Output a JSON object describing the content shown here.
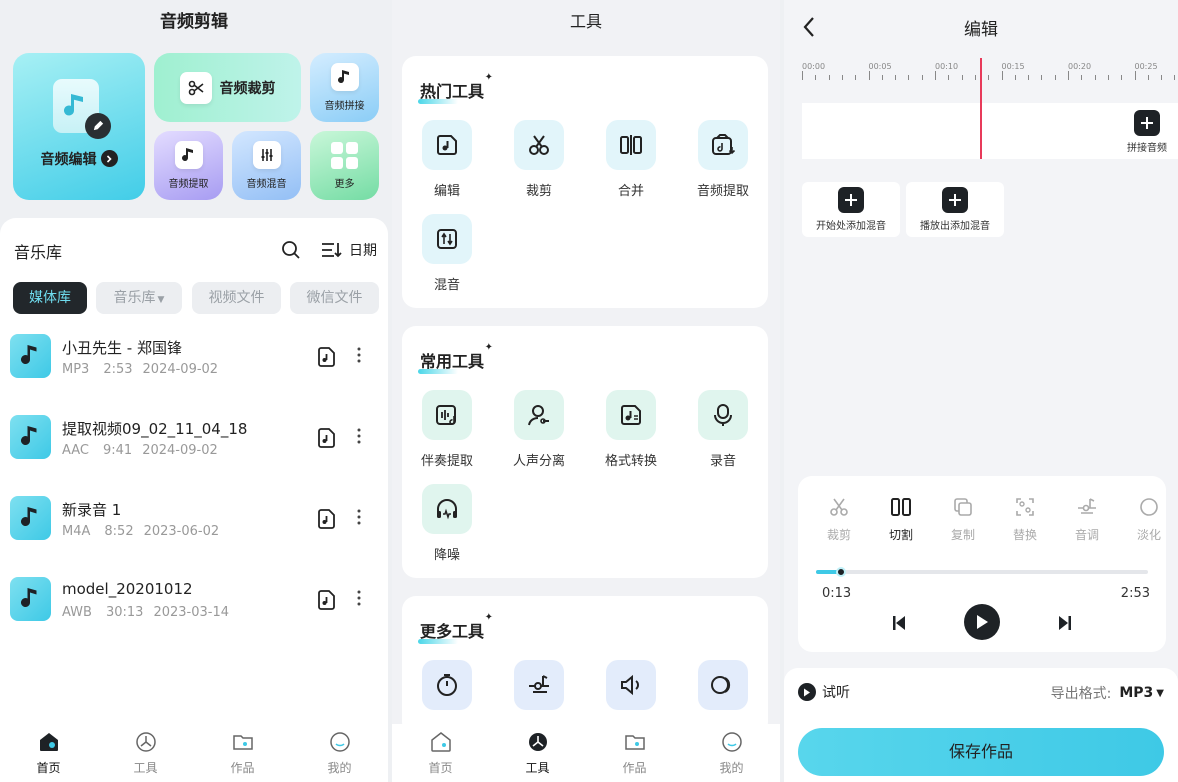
{
  "colors": {
    "accent": "#3ec9e6",
    "playhead": "#e83a5a",
    "dark": "#1e2226"
  },
  "home": {
    "title": "音频剪辑",
    "main_card": {
      "label": "音频编辑",
      "icon": "music-edit-icon"
    },
    "cards": [
      {
        "label": "音频裁剪",
        "icon": "scissors-icon"
      },
      {
        "label": "音频拼接",
        "icon": "splice-icon"
      },
      {
        "label": "音频提取",
        "icon": "extract-icon"
      },
      {
        "label": "音频混音",
        "icon": "mix-icon"
      },
      {
        "label": "更多",
        "icon": "grid-icon"
      }
    ],
    "library": {
      "title": "音乐库",
      "sort_label": "日期"
    },
    "filters": [
      "媒体库",
      "音乐库",
      "视频文件",
      "微信文件"
    ],
    "files": [
      {
        "name": "小丑先生 - 郑国锋",
        "format": "MP3",
        "duration": "2:53",
        "date": "2024-09-02"
      },
      {
        "name": "提取视频09_02_11_04_18",
        "format": "AAC",
        "duration": "9:41",
        "date": "2024-09-02"
      },
      {
        "name": "新录音 1",
        "format": "M4A",
        "duration": "8:52",
        "date": "2023-06-02"
      },
      {
        "name": "model_20201012",
        "format": "AWB",
        "duration": "30:13",
        "date": "2023-03-14"
      }
    ]
  },
  "tabbar": [
    "首页",
    "工具",
    "作品",
    "我的"
  ],
  "tools": {
    "title": "工具",
    "sections": [
      {
        "title": "热门工具",
        "items": [
          "编辑",
          "裁剪",
          "合并",
          "音频提取",
          "混音"
        ]
      },
      {
        "title": "常用工具",
        "items": [
          "伴奏提取",
          "人声分离",
          "格式转换",
          "录音",
          "降噪"
        ]
      },
      {
        "title": "更多工具",
        "items": [
          "",
          "",
          "",
          ""
        ]
      }
    ]
  },
  "editor": {
    "title": "编辑",
    "ruler": [
      "00:00",
      "00:05",
      "00:10",
      "00:15",
      "00:20",
      "00:25"
    ],
    "splice_label": "拼接音频",
    "mix_buttons": [
      "开始处添加混音",
      "播放出添加混音"
    ],
    "controls": [
      "裁剪",
      "切割",
      "复制",
      "替换",
      "音调",
      "淡化"
    ],
    "time_current": "0:13",
    "time_total": "2:53",
    "progress": 0.075,
    "preview_label": "试听",
    "format_label": "导出格式:",
    "format_value": "MP3",
    "save_label": "保存作品"
  }
}
